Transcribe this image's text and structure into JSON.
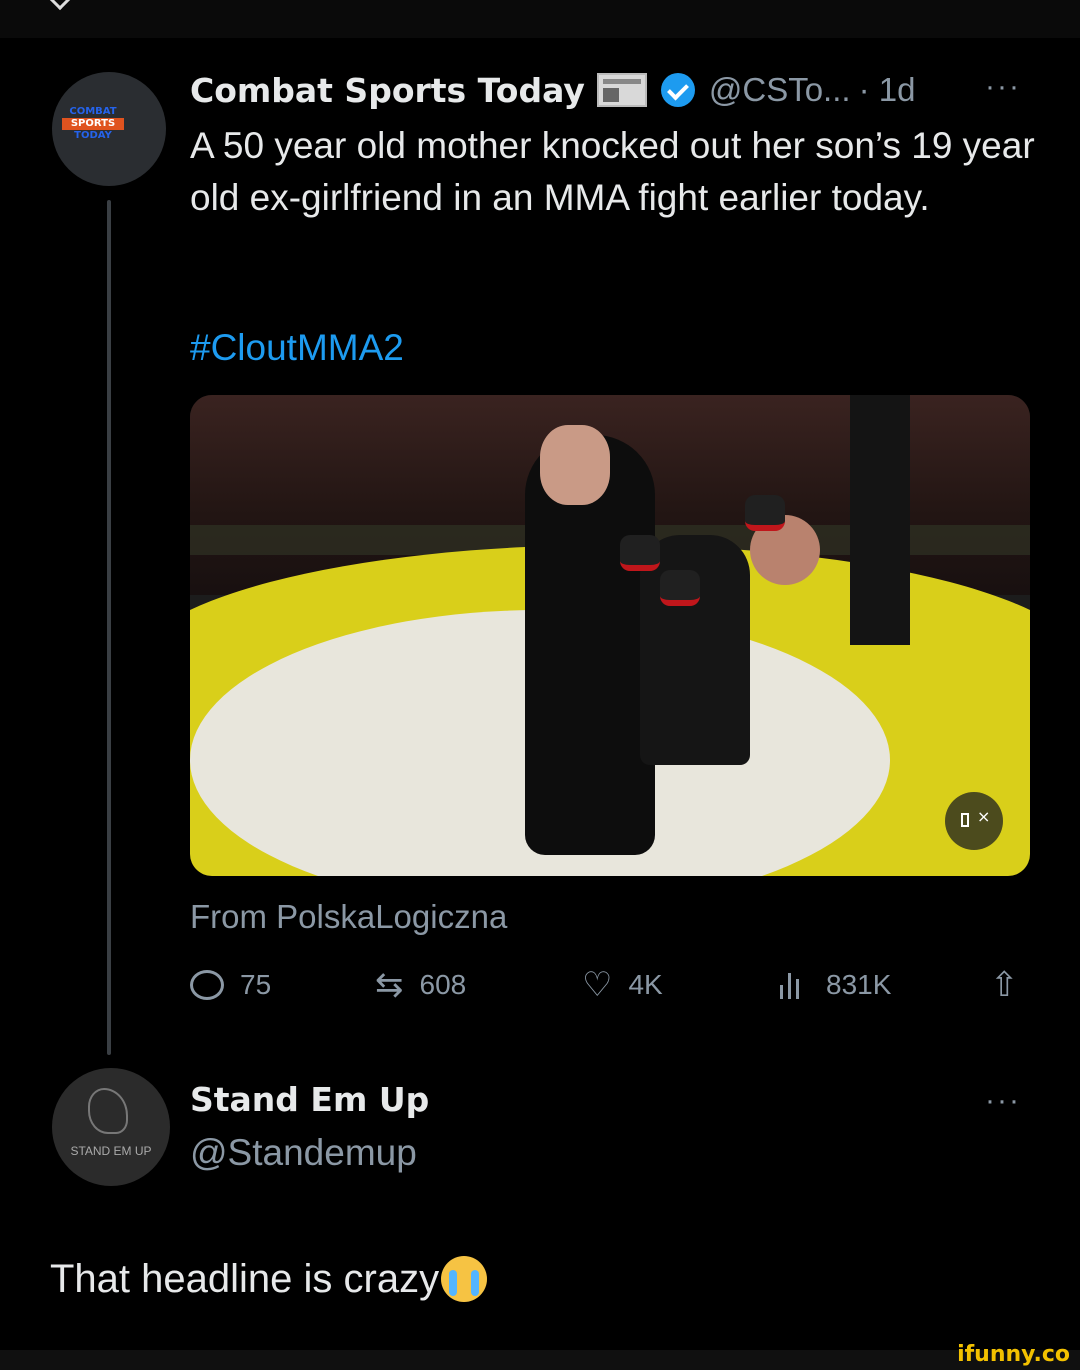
{
  "tweet": {
    "author_name": "Combat Sports Today",
    "author_handle": "@CSTo...",
    "time": "· 1d",
    "avatar_text": [
      "COMBAT",
      "SPORTS",
      "TODAY"
    ],
    "text": "A 50 year old mother knocked out her son’s 19 year old ex-girlfriend in an MMA fight earlier today.",
    "hashtag": "#CloutMMA2",
    "media_source": "From PolskaLogiczna",
    "stats": {
      "replies": "75",
      "reposts": "608",
      "likes": "4K",
      "views": "831K"
    },
    "more_label": "···"
  },
  "reply_author": {
    "name": "Stand Em Up",
    "handle": "@Standemup",
    "avatar_text": "STAND EM UP",
    "more_label": "···"
  },
  "comment": "That headline is crazy",
  "watermark": "ifunny.co",
  "colors": {
    "background": "#000000",
    "text": "#e7e9ea",
    "secondary": "#8b98a5",
    "link": "#1d9bf0",
    "verified": "#1d9bf0"
  }
}
